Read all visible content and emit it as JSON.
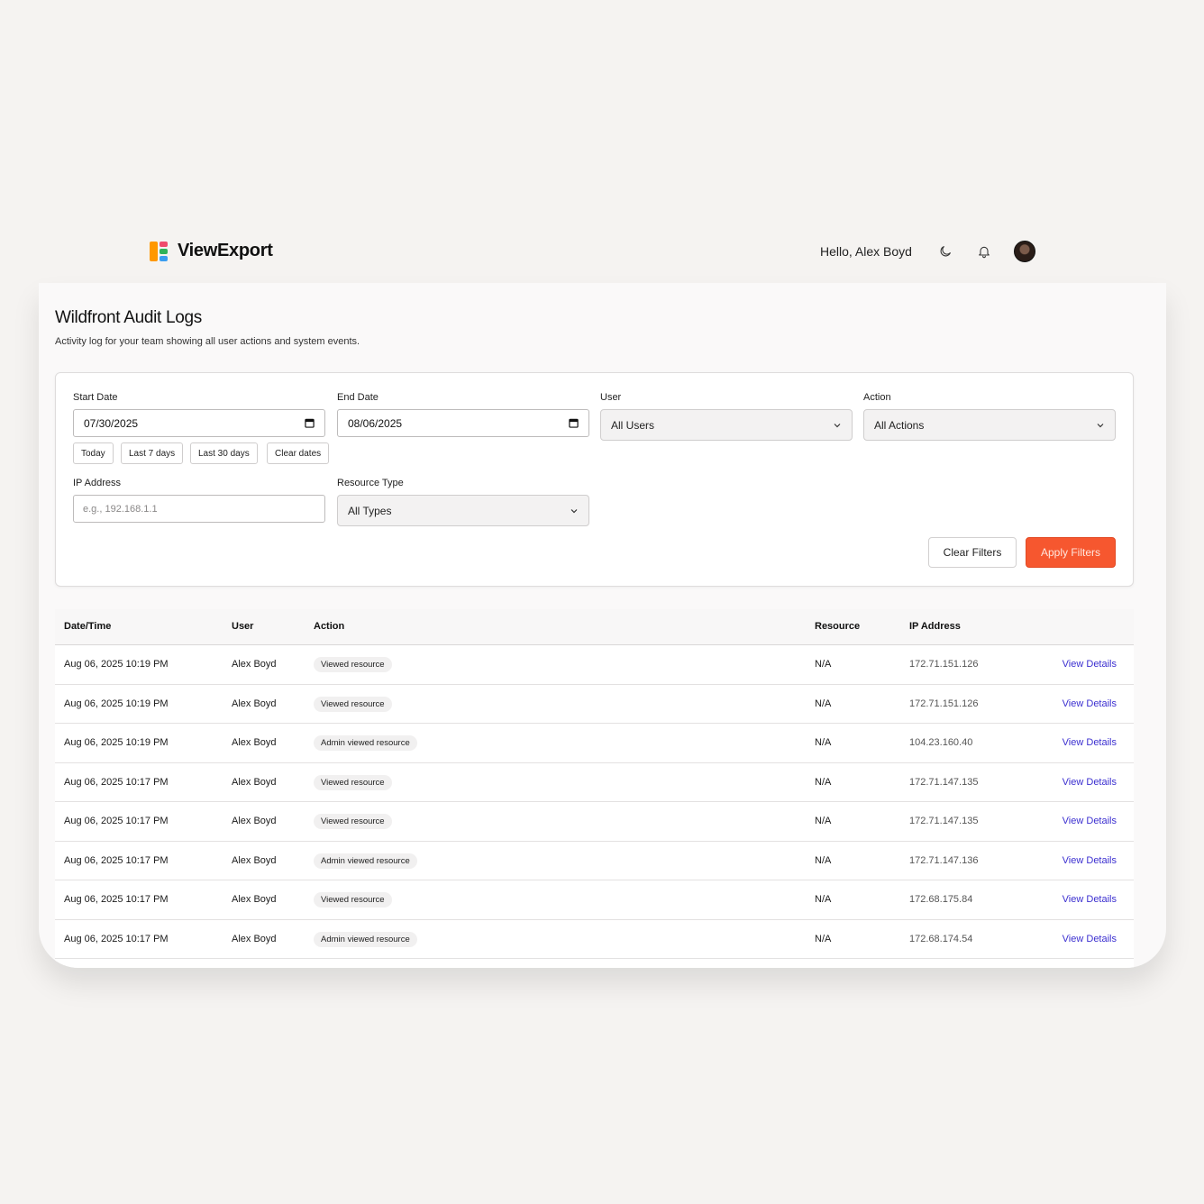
{
  "app": {
    "name": "ViewExport",
    "greeting": "Hello, Alex Boyd"
  },
  "icons": {
    "logo": "viewexport-logo",
    "theme": "moon-icon",
    "notifications": "bell-icon",
    "avatar": "user-avatar"
  },
  "page": {
    "title": "Wildfront Audit Logs",
    "subtitle": "Activity log for your team showing all user actions and system events."
  },
  "filters": {
    "start_date_label": "Start Date",
    "start_date_value": "07/30/2025",
    "end_date_label": "End Date",
    "end_date_value": "08/06/2025",
    "user_label": "User",
    "user_value": "All Users",
    "action_label": "Action",
    "action_value": "All Actions",
    "ip_label": "IP Address",
    "ip_placeholder": "e.g., 192.168.1.1",
    "resource_type_label": "Resource Type",
    "resource_type_value": "All Types",
    "quick_ranges": [
      "Today",
      "Last 7 days",
      "Last 30 days",
      "Clear dates"
    ],
    "clear_button": "Clear Filters",
    "apply_button": "Apply Filters"
  },
  "colors": {
    "accent": "#f6572f",
    "link": "#3b2fd0"
  },
  "table": {
    "headers": [
      "Date/Time",
      "User",
      "Action",
      "Resource",
      "IP Address"
    ],
    "rows": [
      {
        "datetime": "Aug 06, 2025 10:19 PM",
        "user": "Alex Boyd",
        "action": "Viewed resource",
        "resource": "N/A",
        "ip": "172.71.151.126",
        "link": "View Details"
      },
      {
        "datetime": "Aug 06, 2025 10:19 PM",
        "user": "Alex Boyd",
        "action": "Viewed resource",
        "resource": "N/A",
        "ip": "172.71.151.126",
        "link": "View Details"
      },
      {
        "datetime": "Aug 06, 2025 10:19 PM",
        "user": "Alex Boyd",
        "action": "Admin viewed resource",
        "resource": "N/A",
        "ip": "104.23.160.40",
        "link": "View Details"
      },
      {
        "datetime": "Aug 06, 2025 10:17 PM",
        "user": "Alex Boyd",
        "action": "Viewed resource",
        "resource": "N/A",
        "ip": "172.71.147.135",
        "link": "View Details"
      },
      {
        "datetime": "Aug 06, 2025 10:17 PM",
        "user": "Alex Boyd",
        "action": "Viewed resource",
        "resource": "N/A",
        "ip": "172.71.147.135",
        "link": "View Details"
      },
      {
        "datetime": "Aug 06, 2025 10:17 PM",
        "user": "Alex Boyd",
        "action": "Admin viewed resource",
        "resource": "N/A",
        "ip": "172.71.147.136",
        "link": "View Details"
      },
      {
        "datetime": "Aug 06, 2025 10:17 PM",
        "user": "Alex Boyd",
        "action": "Viewed resource",
        "resource": "N/A",
        "ip": "172.68.175.84",
        "link": "View Details"
      },
      {
        "datetime": "Aug 06, 2025 10:17 PM",
        "user": "Alex Boyd",
        "action": "Admin viewed resource",
        "resource": "N/A",
        "ip": "172.68.174.54",
        "link": "View Details"
      }
    ]
  }
}
